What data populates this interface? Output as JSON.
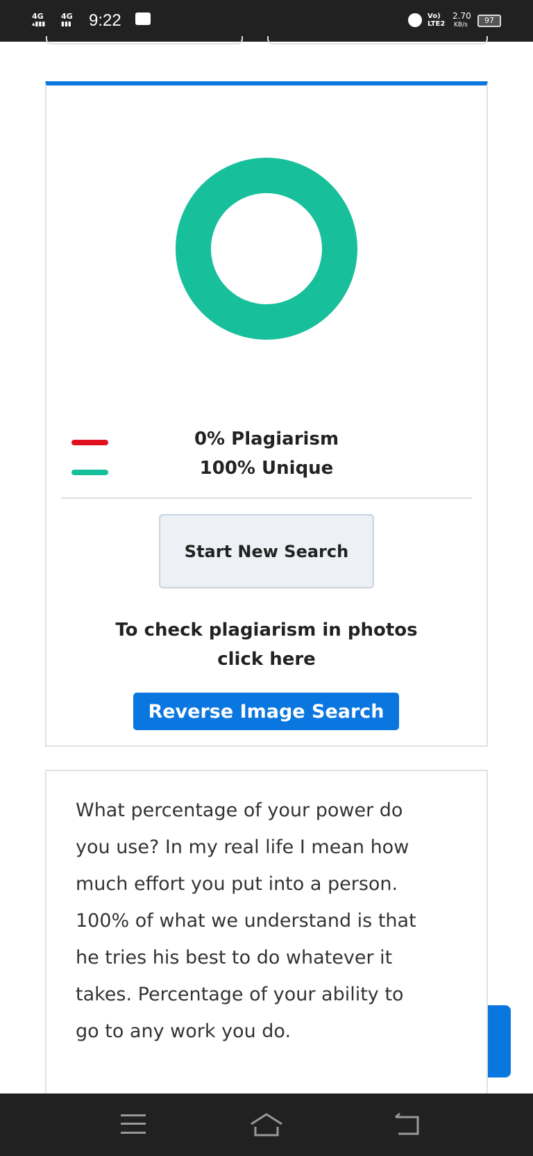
{
  "status_bar": {
    "time": "9:22",
    "net1": "4G",
    "net2": "4G",
    "volte": "Vo) LTE2",
    "speed": "2.70",
    "speed_unit": "KB/s",
    "battery": "97"
  },
  "result": {
    "plagiarism_label": "0% Plagiarism",
    "unique_label": "100% Unique",
    "plagiarism_pct": 0,
    "unique_pct": 100,
    "colors": {
      "plagiarism": "#e0101e",
      "unique": "#17bf9b",
      "accent": "#0a76e0"
    }
  },
  "actions": {
    "start_new_search": "Start New Search",
    "photo_hint_line1": "To check plagiarism in photos",
    "photo_hint_line2": "click here",
    "reverse_image_search": "Reverse Image Search"
  },
  "content": {
    "lines": [
      "What percentage of your power do",
      "you use? In my real life I mean how",
      "much effort you put into a person.",
      "100% of what we understand is that",
      "he tries his best to do whatever it",
      "takes.  Percentage of your ability to",
      "go to any work you do."
    ]
  }
}
